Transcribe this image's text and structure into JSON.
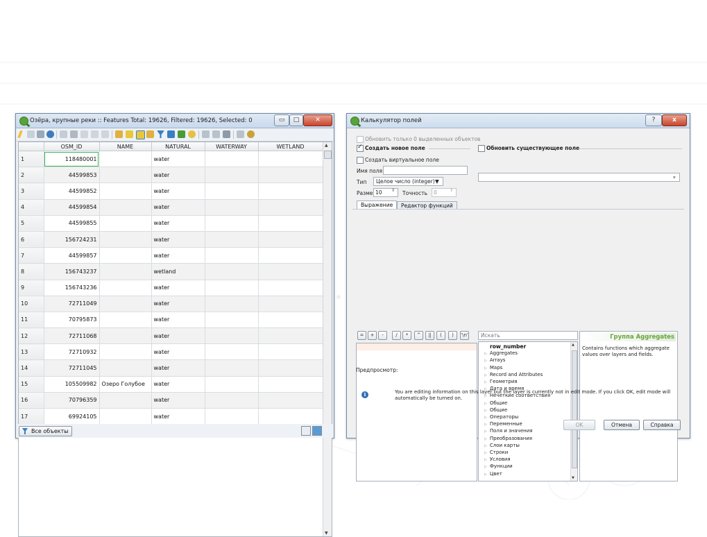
{
  "colors": {
    "accent": "#5aa23a",
    "selection": "#38b45a",
    "group_title": "#6ca33a"
  },
  "attr_window": {
    "title": "Озёра, крупные реки :: Features Total: 19626, Filtered: 19626, Selected: 0",
    "columns": [
      "OSM_ID",
      "NAME",
      "NATURAL",
      "WATERWAY",
      "WETLAND"
    ],
    "rows": [
      {
        "n": "1",
        "osm": "118480001",
        "name": "",
        "natural": "water"
      },
      {
        "n": "2",
        "osm": "44599853",
        "name": "",
        "natural": "water"
      },
      {
        "n": "3",
        "osm": "44599852",
        "name": "",
        "natural": "water"
      },
      {
        "n": "4",
        "osm": "44599854",
        "name": "",
        "natural": "water"
      },
      {
        "n": "5",
        "osm": "44599855",
        "name": "",
        "natural": "water"
      },
      {
        "n": "6",
        "osm": "156724231",
        "name": "",
        "natural": "water"
      },
      {
        "n": "7",
        "osm": "44599857",
        "name": "",
        "natural": "water"
      },
      {
        "n": "8",
        "osm": "156743237",
        "name": "",
        "natural": "wetland"
      },
      {
        "n": "9",
        "osm": "156743236",
        "name": "",
        "natural": "water"
      },
      {
        "n": "10",
        "osm": "72711049",
        "name": "",
        "natural": "water"
      },
      {
        "n": "11",
        "osm": "70795873",
        "name": "",
        "natural": "water"
      },
      {
        "n": "12",
        "osm": "72711068",
        "name": "",
        "natural": "water"
      },
      {
        "n": "13",
        "osm": "72710932",
        "name": "",
        "natural": "water"
      },
      {
        "n": "14",
        "osm": "72711045",
        "name": "",
        "natural": "water"
      },
      {
        "n": "15",
        "osm": "105509982",
        "name": "Озеро Голубое",
        "natural": "water"
      },
      {
        "n": "16",
        "osm": "70796359",
        "name": "",
        "natural": "water"
      },
      {
        "n": "17",
        "osm": "69924105",
        "name": "",
        "natural": "water"
      }
    ],
    "filter_button": "Все объекты"
  },
  "calc_window": {
    "title": "Калькулятор полей",
    "help_glyph": "?",
    "close_glyph": "x",
    "only_selected": "Обновить только 0 выделенных объектов",
    "create_new": "Создать новое поле",
    "update_existing": "Обновить существующее поле",
    "virtual_field": "Создать виртуальное поле",
    "field_name_label": "Имя поля",
    "field_name_value": "",
    "type_label": "Тип",
    "type_value": "Целое число (integer)",
    "size_label": "Размер",
    "size_value": "10",
    "precision_label": "Точность",
    "precision_value": "0",
    "tabs": [
      "Выражение",
      "Редактор функций"
    ],
    "operators": [
      "=",
      "+",
      "-",
      "/",
      "*",
      "^",
      "||",
      "(",
      ")",
      "'\\n'"
    ],
    "search_placeholder": "Искать",
    "function_items": [
      "row_number",
      "Aggregates",
      "Arrays",
      "Maps",
      "Record and Attributes",
      "Геометрия",
      "Дата и время",
      "Нечеткие соответствия",
      "Общие",
      "Общие",
      "Операторы",
      "Переменные",
      "Поля и значения",
      "Преобразования",
      "Слои карты",
      "Строки",
      "Условия",
      "Функции",
      "Цвет"
    ],
    "group_title": "Группа Aggregates",
    "group_desc": "Contains functions which aggregate values over layers and fields.",
    "preview_label": "Предпросмотр:",
    "info_text": "You are editing information on this layer but the layer is currently not in edit mode. If you click OK, edit mode will automatically be turned on.",
    "ok": "OK",
    "cancel": "Отмена",
    "help": "Справка"
  }
}
